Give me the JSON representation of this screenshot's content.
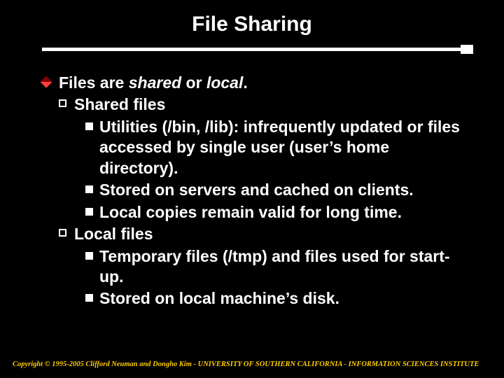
{
  "title": "File Sharing",
  "main": {
    "prefix": "Files are ",
    "em1": "shared",
    "mid": " or ",
    "em2": "local",
    "suffix": "."
  },
  "shared": {
    "label": "Shared files",
    "b1": "Utilities (/bin, /lib): infrequently updated or files accessed by single user (user’s home directory).",
    "b2": "Stored on servers and cached on clients.",
    "b3": "Local copies remain valid for long time."
  },
  "local": {
    "label": "Local files",
    "b1": "Temporary files (/tmp) and files used for start-up.",
    "b2": "Stored on local machine’s disk."
  },
  "footer": "Copyright © 1995-2005 Clifford Neuman and Dongho Kim - UNIVERSITY OF SOUTHERN CALIFORNIA - INFORMATION SCIENCES INSTITUTE"
}
